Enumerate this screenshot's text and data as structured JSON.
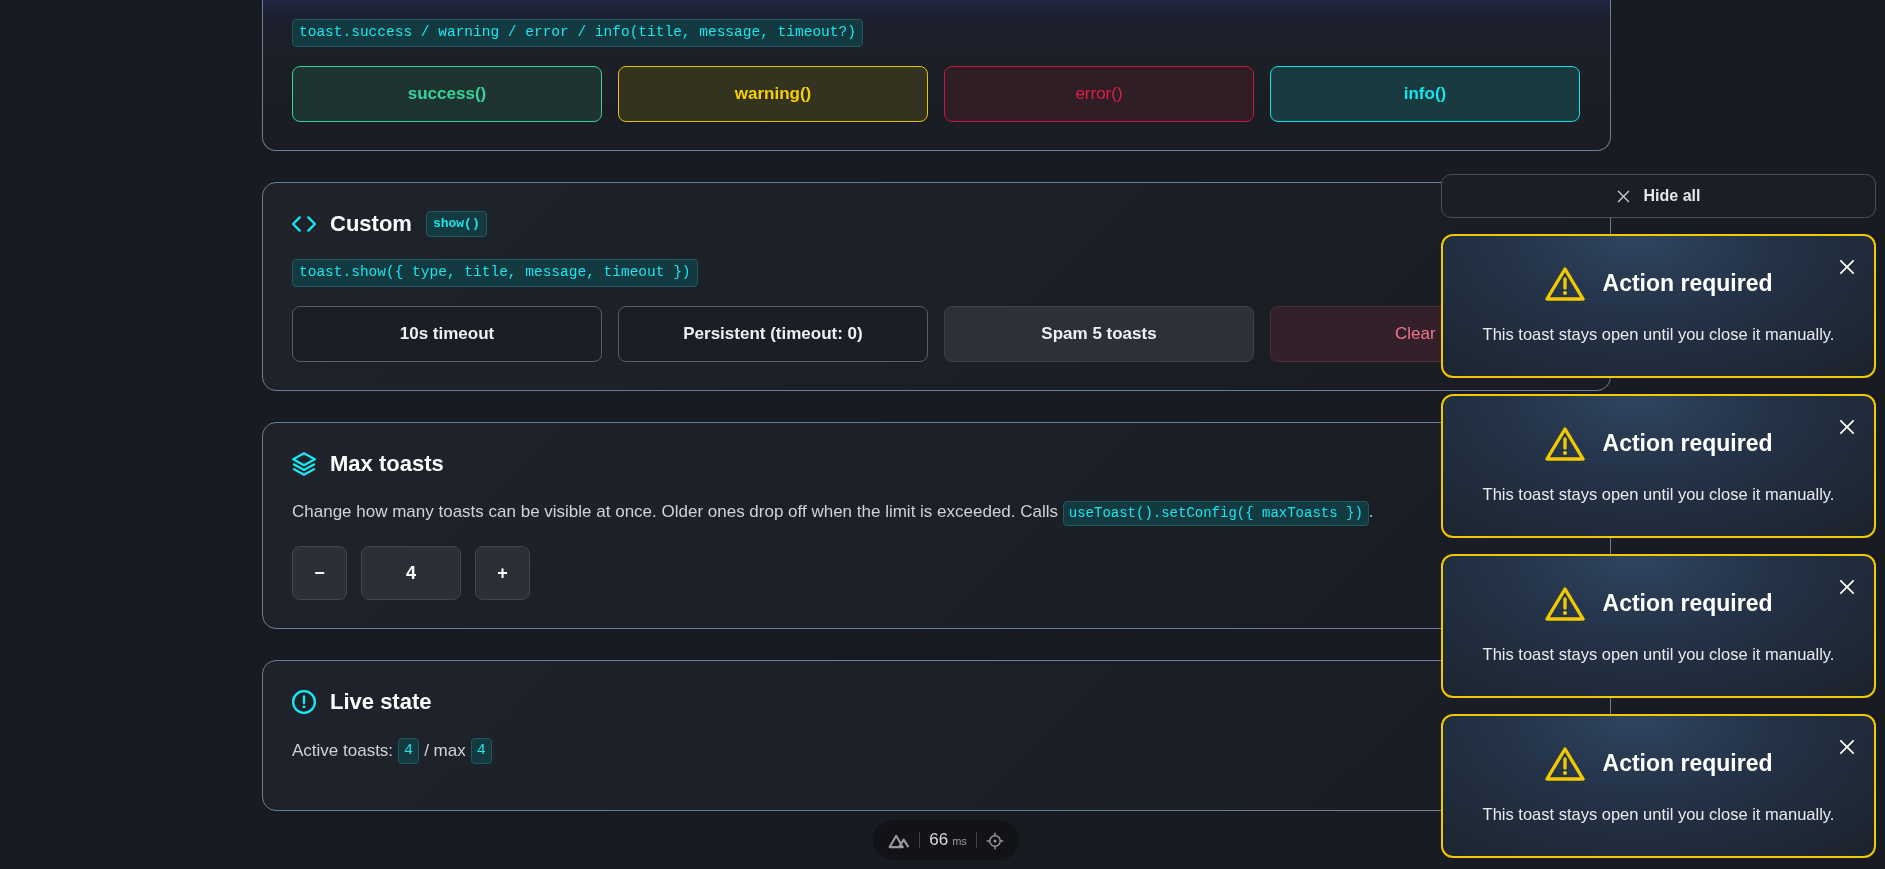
{
  "api_card": {
    "signature": "toast.success / warning / error / info(title, message, timeout?)",
    "buttons": [
      {
        "label": "success()",
        "kind": "success"
      },
      {
        "label": "warning()",
        "kind": "warning"
      },
      {
        "label": "error()",
        "kind": "error"
      },
      {
        "label": "info()",
        "kind": "info"
      }
    ]
  },
  "custom_card": {
    "title": "Custom",
    "badge": "show()",
    "signature": "toast.show({ type, title, message, timeout })",
    "buttons": [
      {
        "label": "10s timeout",
        "kind": "plain"
      },
      {
        "label": "Persistent (timeout: 0)",
        "kind": "plain"
      },
      {
        "label": "Spam 5 toasts",
        "kind": "muted"
      },
      {
        "label": "Clear",
        "kind": "danger"
      }
    ]
  },
  "max_card": {
    "title": "Max toasts",
    "description": "Change how many toasts can be visible at once. Older ones drop off when the limit is exceeded. Calls",
    "code": "useToast().setConfig({ maxToasts })",
    "trailing": ".",
    "decrement": "−",
    "value": "4",
    "increment": "+"
  },
  "live_card": {
    "title": "Live state",
    "label": "Active toasts:",
    "active": "4",
    "separator": "/ max",
    "max": "4"
  },
  "hide_all": "Hide all",
  "toasts": [
    {
      "kind": "warning",
      "title": "Action required",
      "message": "This toast stays open until you close it manually."
    },
    {
      "kind": "warning",
      "title": "Action required",
      "message": "This toast stays open until you close it manually."
    },
    {
      "kind": "warning",
      "title": "Action required",
      "message": "This toast stays open until you close it manually."
    },
    {
      "kind": "warning",
      "title": "Action required",
      "message": "This toast stays open until you close it manually."
    }
  ],
  "devtools": {
    "timing": "66",
    "unit": "ms"
  }
}
